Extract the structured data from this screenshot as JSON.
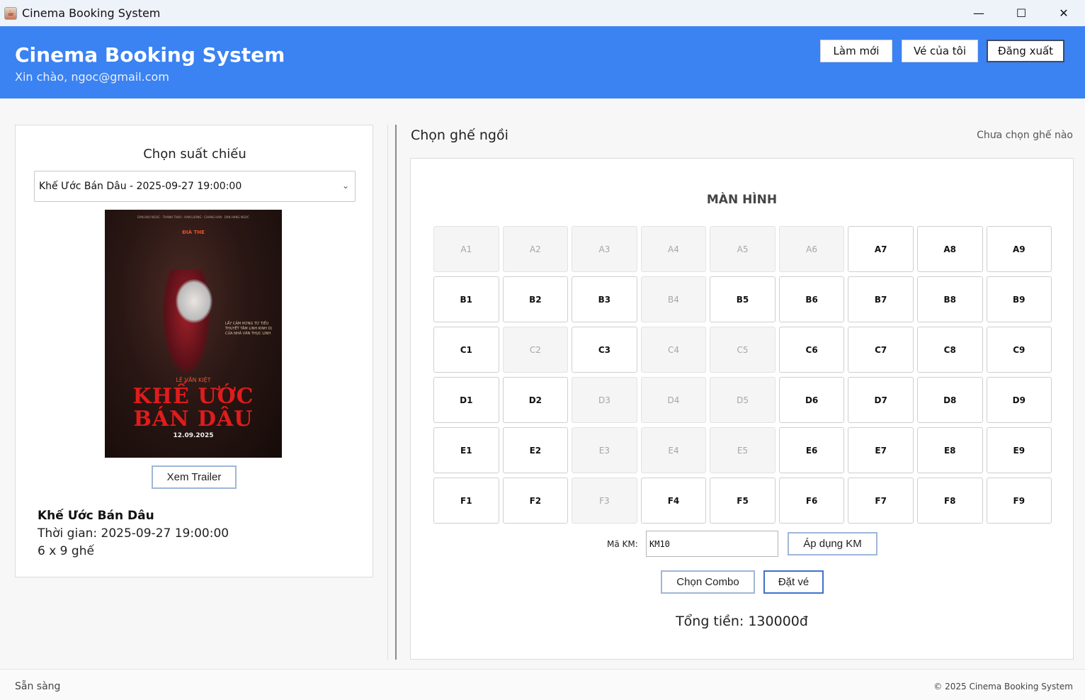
{
  "window": {
    "title": "Cinema Booking System",
    "icon": "java-cup-icon",
    "controls": {
      "minimize": "—",
      "maximize": "☐",
      "close": "✕"
    }
  },
  "header": {
    "title": "Cinema Booking System",
    "greeting": "Xin chào, ngoc@gmail.com",
    "background": "#3b82f2",
    "buttons": {
      "refresh": "Làm mới",
      "my_tickets": "Vé của tôi",
      "logout": "Đăng xuất"
    }
  },
  "left_panel": {
    "title": "Chọn suất chiếu",
    "showtime_select": "Khế Ước Bán Dâu - 2025-09-27 19:00:00",
    "poster": {
      "credits": "DAN BAO NGOC · THANH THAO · HAN LUONG · CHANG HAN · DAN HANG NGOC",
      "studio": "ĐIÀ THE",
      "tagline": "LẤY CẢM HỨNG TỪ TIỂU THUYẾT TÂM LINH KINH DỊ CỦA NHÀ VĂN THỤC LINH",
      "director": "LÊ VĂN KIỆT",
      "title": "KHẾ ƯỚC BÁN DÂU",
      "date": "12.09.2025"
    },
    "trailer_button": "Xem Trailer",
    "movie_name": "Khế Ước Bán Dâu",
    "movie_time": "Thời gian: 2025-09-27 19:00:00",
    "seat_layout": "6 x 9 ghế"
  },
  "right_panel": {
    "heading": "Chọn ghế ngồi",
    "selection_status": "Chưa chọn ghế nào",
    "screen_label": "MÀN HÌNH",
    "seat_rows": [
      {
        "row": "A",
        "seats": [
          {
            "label": "A1",
            "booked": true
          },
          {
            "label": "A2",
            "booked": true
          },
          {
            "label": "A3",
            "booked": true
          },
          {
            "label": "A4",
            "booked": true
          },
          {
            "label": "A5",
            "booked": true
          },
          {
            "label": "A6",
            "booked": true
          },
          {
            "label": "A7",
            "booked": false
          },
          {
            "label": "A8",
            "booked": false
          },
          {
            "label": "A9",
            "booked": false
          }
        ]
      },
      {
        "row": "B",
        "seats": [
          {
            "label": "B1",
            "booked": false
          },
          {
            "label": "B2",
            "booked": false
          },
          {
            "label": "B3",
            "booked": false
          },
          {
            "label": "B4",
            "booked": true
          },
          {
            "label": "B5",
            "booked": false
          },
          {
            "label": "B6",
            "booked": false
          },
          {
            "label": "B7",
            "booked": false
          },
          {
            "label": "B8",
            "booked": false
          },
          {
            "label": "B9",
            "booked": false
          }
        ]
      },
      {
        "row": "C",
        "seats": [
          {
            "label": "C1",
            "booked": false
          },
          {
            "label": "C2",
            "booked": true
          },
          {
            "label": "C3",
            "booked": false
          },
          {
            "label": "C4",
            "booked": true
          },
          {
            "label": "C5",
            "booked": true
          },
          {
            "label": "C6",
            "booked": false
          },
          {
            "label": "C7",
            "booked": false
          },
          {
            "label": "C8",
            "booked": false
          },
          {
            "label": "C9",
            "booked": false
          }
        ]
      },
      {
        "row": "D",
        "seats": [
          {
            "label": "D1",
            "booked": false
          },
          {
            "label": "D2",
            "booked": false
          },
          {
            "label": "D3",
            "booked": true
          },
          {
            "label": "D4",
            "booked": true
          },
          {
            "label": "D5",
            "booked": true
          },
          {
            "label": "D6",
            "booked": false
          },
          {
            "label": "D7",
            "booked": false
          },
          {
            "label": "D8",
            "booked": false
          },
          {
            "label": "D9",
            "booked": false
          }
        ]
      },
      {
        "row": "E",
        "seats": [
          {
            "label": "E1",
            "booked": false
          },
          {
            "label": "E2",
            "booked": false
          },
          {
            "label": "E3",
            "booked": true
          },
          {
            "label": "E4",
            "booked": true
          },
          {
            "label": "E5",
            "booked": true
          },
          {
            "label": "E6",
            "booked": false
          },
          {
            "label": "E7",
            "booked": false
          },
          {
            "label": "E8",
            "booked": false
          },
          {
            "label": "E9",
            "booked": false
          }
        ]
      },
      {
        "row": "F",
        "seats": [
          {
            "label": "F1",
            "booked": false
          },
          {
            "label": "F2",
            "booked": false
          },
          {
            "label": "F3",
            "booked": true
          },
          {
            "label": "F4",
            "booked": false
          },
          {
            "label": "F5",
            "booked": false
          },
          {
            "label": "F6",
            "booked": false
          },
          {
            "label": "F7",
            "booked": false
          },
          {
            "label": "F8",
            "booked": false
          },
          {
            "label": "F9",
            "booked": false
          }
        ]
      }
    ],
    "promo": {
      "label": "Mã KM:",
      "value": "KM10",
      "apply_button": "Áp dụng KM"
    },
    "combo_button": "Chọn Combo",
    "book_button": "Đặt vé",
    "total": "Tổng tiền: 130000đ"
  },
  "statusbar": {
    "left": "Sẵn sàng",
    "right": "© 2025 Cinema Booking System"
  }
}
